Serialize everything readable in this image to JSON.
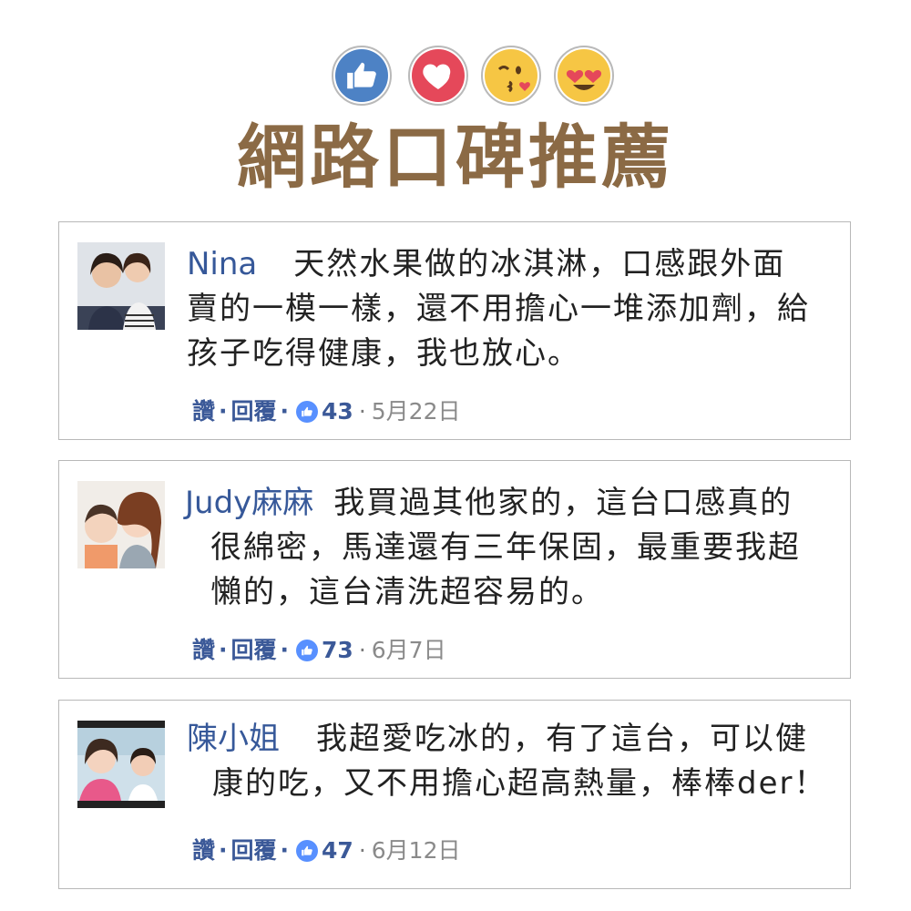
{
  "header": {
    "reactions": [
      {
        "icon": "like-icon",
        "color": "#4d82c5"
      },
      {
        "icon": "love-icon",
        "color": "#e5485a"
      },
      {
        "icon": "kiss-emoji-icon",
        "color": "#f6c644"
      },
      {
        "icon": "heart-eyes-emoji-icon",
        "color": "#f6c644"
      }
    ],
    "title": "網路口碑推薦",
    "title_color": "#8b6a45"
  },
  "cards": [
    {
      "name": "Nina",
      "lines": [
        "天然水果做的冰淇淋，口感跟外面",
        "賣的一模一樣，還不用擔心一堆添加劑，給",
        "孩子吃得健康，我也放心。"
      ],
      "like_label": "讚",
      "reply_label": "回覆",
      "likes": "43",
      "date": "5月22日"
    },
    {
      "name": "Judy麻麻",
      "lines": [
        "我買過其他家的，這台口感真的",
        "很綿密，馬達還有三年保固，最重要我超",
        "懶的，這台清洗超容易的。"
      ],
      "like_label": "讚",
      "reply_label": "回覆",
      "likes": "73",
      "date": "6月7日"
    },
    {
      "name": "陳小姐",
      "lines": [
        "我超愛吃冰的，有了這台，可以健",
        "康的吃，又不用擔心超高熱量，棒棒der！"
      ],
      "like_label": "讚",
      "reply_label": "回覆",
      "likes": "47",
      "date": "6月12日"
    }
  ],
  "colors": {
    "name_link": "#365899",
    "facebook_blue": "#3b5998",
    "like_badge": "#5890ff",
    "border": "#b8b8b8"
  }
}
